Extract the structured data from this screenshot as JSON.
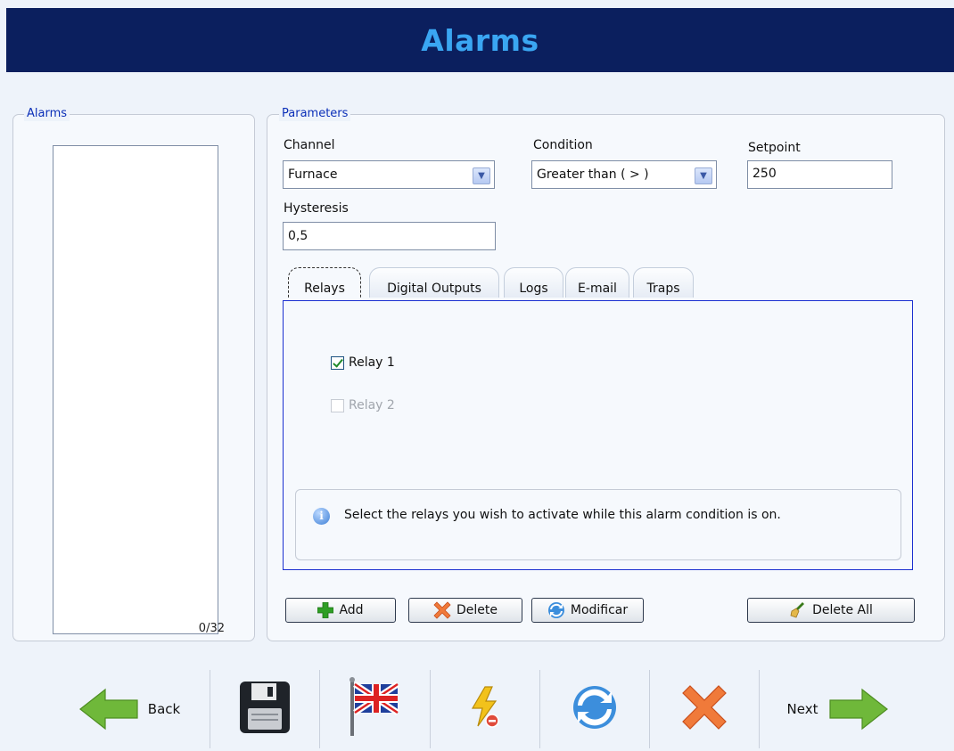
{
  "header": {
    "title": "Alarms"
  },
  "alarms_panel": {
    "legend": "Alarms",
    "count": "0/32"
  },
  "parameters": {
    "legend": "Parameters",
    "channel": {
      "label": "Channel",
      "value": "Furnace"
    },
    "condition": {
      "label": "Condition",
      "value": "Greater than ( > )"
    },
    "setpoint": {
      "label": "Setpoint",
      "value": "250"
    },
    "hysteresis": {
      "label": "Hysteresis",
      "value": "0,5"
    }
  },
  "tabs": [
    {
      "label": "Relays",
      "active": true
    },
    {
      "label": "Digital Outputs"
    },
    {
      "label": "Logs"
    },
    {
      "label": "E-mail"
    },
    {
      "label": "Traps"
    }
  ],
  "relays": [
    {
      "label": "Relay 1",
      "checked": true,
      "enabled": true
    },
    {
      "label": "Relay 2",
      "checked": false,
      "enabled": false
    }
  ],
  "info": {
    "text": "Select the relays you wish to activate while this alarm condition is on."
  },
  "actions": {
    "add": "Add",
    "delete": "Delete",
    "modify": "Modificar",
    "delete_all": "Delete All"
  },
  "toolbar": {
    "back": "Back",
    "next": "Next",
    "icons": [
      "save-icon",
      "language-flag-icon",
      "power-icon",
      "refresh-icon",
      "cancel-icon"
    ]
  },
  "colors": {
    "header_bg": "#0b1f5e",
    "header_title": "#3aa6f2",
    "legend": "#0b2fb8",
    "accent_green": "#5aa52a",
    "accent_red": "#e0552a",
    "accent_blue": "#1b2fd0"
  }
}
